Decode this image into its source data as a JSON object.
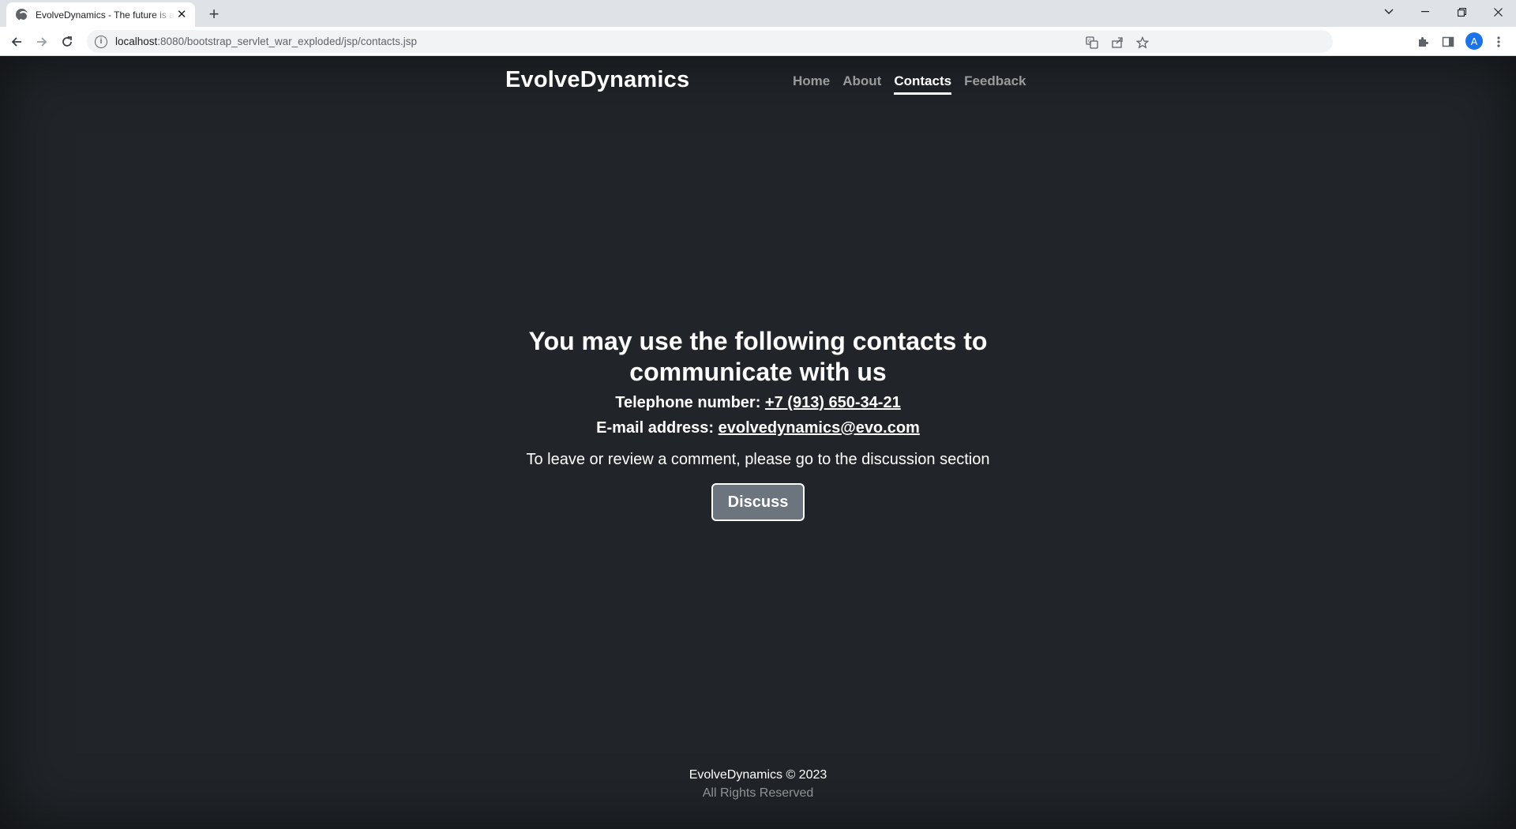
{
  "browser": {
    "tab_title": "EvolveDynamics - The future is al",
    "url_host": "localhost",
    "url_rest": ":8080/bootstrap_servlet_war_exploded/jsp/contacts.jsp",
    "profile_initial": "A"
  },
  "header": {
    "brand": "EvolveDynamics",
    "nav": [
      {
        "label": "Home"
      },
      {
        "label": "About"
      },
      {
        "label": "Contacts",
        "active": true
      },
      {
        "label": "Feedback"
      }
    ]
  },
  "main": {
    "heading": "You may use the following contacts to communicate with us",
    "phone_label": "Telephone number:",
    "phone_value": "+7 (913) 650-34-21",
    "email_label": "E-mail address:",
    "email_value": "evolvedynamics@evo.com",
    "lead": "To leave or review a comment, please go to the discussion section",
    "discuss_button": "Discuss"
  },
  "footer": {
    "copyright": "EvolveDynamics © 2023",
    "rights": "All Rights Reserved"
  },
  "colors": {
    "page_bg": "#212529",
    "button_bg": "#6c757d",
    "profile_bg": "#1a73e8"
  }
}
